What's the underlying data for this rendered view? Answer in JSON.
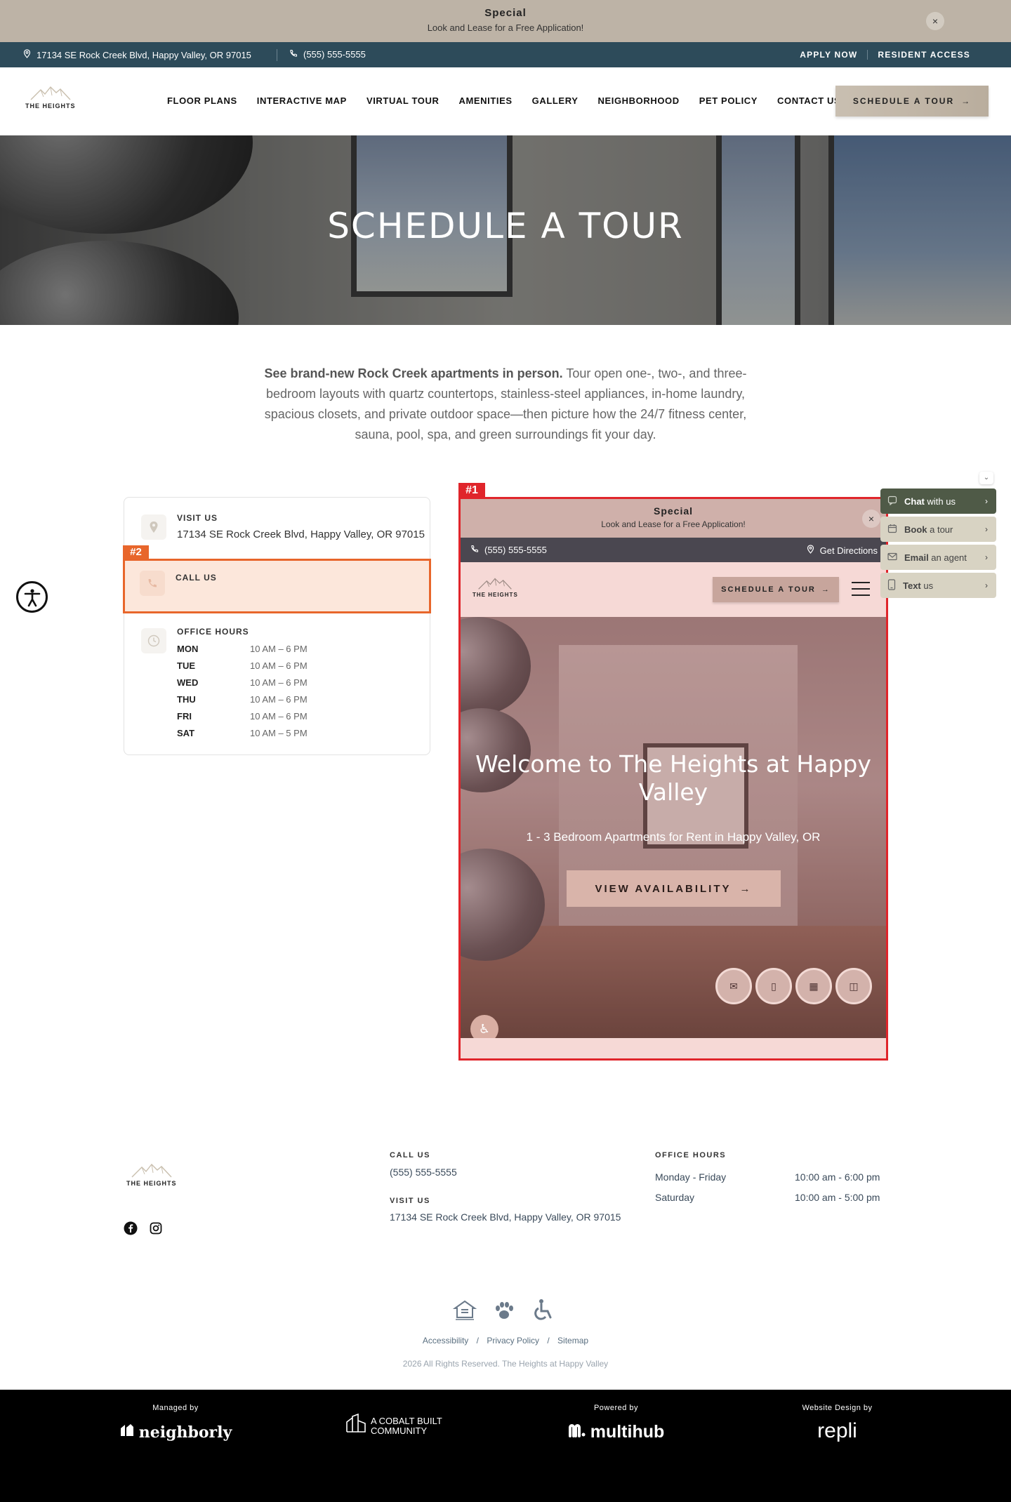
{
  "promo": {
    "title": "Special",
    "subtitle": "Look and Lease for a Free Application!",
    "close": "×"
  },
  "topbar": {
    "address": "17134 SE Rock Creek Blvd, Happy Valley, OR 97015",
    "phone": "(555) 555-5555",
    "apply": "APPLY NOW",
    "resident": "RESIDENT ACCESS"
  },
  "brand": {
    "logo_text": "THE HEIGHTS"
  },
  "nav": {
    "items": [
      "FLOOR PLANS",
      "INTERACTIVE MAP",
      "VIRTUAL TOUR",
      "AMENITIES",
      "GALLERY",
      "NEIGHBORHOOD",
      "PET POLICY",
      "CONTACT US"
    ],
    "cta": "SCHEDULE A TOUR"
  },
  "hero": {
    "title": "SCHEDULE A TOUR"
  },
  "intro": {
    "bold": "See brand-new Rock Creek apartments in person.",
    "rest": " Tour open one-, two-, and three-bedroom layouts with quartz countertops, stainless-steel appliances, in-home laundry, spacious closets, and private outdoor space—then picture how the 24/7 fitness center, sauna, pool, spa, and green surroundings fit your day."
  },
  "contact_card": {
    "visit_label": "VISIT US",
    "visit_value": "17134 SE Rock Creek Blvd, Happy Valley, OR 97015",
    "call_label": "CALL US",
    "call_tag": "#2",
    "hours_label": "OFFICE HOURS",
    "hours": [
      {
        "day": "MON",
        "time": "10 AM – 6 PM"
      },
      {
        "day": "TUE",
        "time": "10 AM – 6 PM"
      },
      {
        "day": "WED",
        "time": "10 AM – 6 PM"
      },
      {
        "day": "THU",
        "time": "10 AM – 6 PM"
      },
      {
        "day": "FRI",
        "time": "10 AM – 6 PM"
      },
      {
        "day": "SAT",
        "time": "10 AM – 5 PM"
      }
    ]
  },
  "embed": {
    "tag": "#1",
    "promo_title": "Special",
    "promo_subtitle": "Look and Lease for a Free Application!",
    "close": "×",
    "phone": "(555) 555-5555",
    "directions": "Get Directions",
    "logo_text": "THE HEIGHTS",
    "cta": "SCHEDULE A TOUR",
    "hero_title": "Welcome to The Heights at Happy Valley",
    "hero_subtitle": "1 - 3 Bedroom Apartments for Rent in Happy Valley, OR",
    "availability": "VIEW AVAILABILITY"
  },
  "widget": {
    "items": [
      {
        "bold": "Chat",
        "rest": " with us",
        "bg": "#4f5a47",
        "fg": "#ffffff",
        "icon": "chat-icon"
      },
      {
        "bold": "Book",
        "rest": " a tour",
        "bg": "#d8d3c3",
        "fg": "#444444",
        "icon": "calendar-icon"
      },
      {
        "bold": "Email",
        "rest": " an agent",
        "bg": "#d8d3c3",
        "fg": "#444444",
        "icon": "email-icon"
      },
      {
        "bold": "Text",
        "rest": " us",
        "bg": "#d8d3c3",
        "fg": "#444444",
        "icon": "phone-icon"
      }
    ],
    "chevron": "›",
    "collapse": "⌄"
  },
  "footer": {
    "logo_text": "THE HEIGHTS",
    "call_label": "CALL US",
    "call_value": "(555) 555-5555",
    "visit_label": "VISIT US",
    "visit_value": "17134 SE Rock Creek Blvd, Happy Valley, OR 97015",
    "hours_label": "OFFICE HOURS",
    "hours": [
      {
        "day": "Monday - Friday",
        "time": "10:00 am - 6:00 pm"
      },
      {
        "day": "Saturday",
        "time": "10:00 am - 5:00 pm"
      }
    ],
    "links": [
      "Accessibility",
      "Privacy Policy",
      "Sitemap"
    ],
    "link_sep": "/",
    "copyright": "2026 All Rights Reserved. The Heights at Happy Valley"
  },
  "partners": [
    {
      "caption": "Managed by",
      "name": "neighborly"
    },
    {
      "caption": "",
      "name": "A COBALT BUILT COMMUNITY"
    },
    {
      "caption": "Powered by",
      "name": "multihub"
    },
    {
      "caption": "Website Design by",
      "name": "repli"
    }
  ]
}
